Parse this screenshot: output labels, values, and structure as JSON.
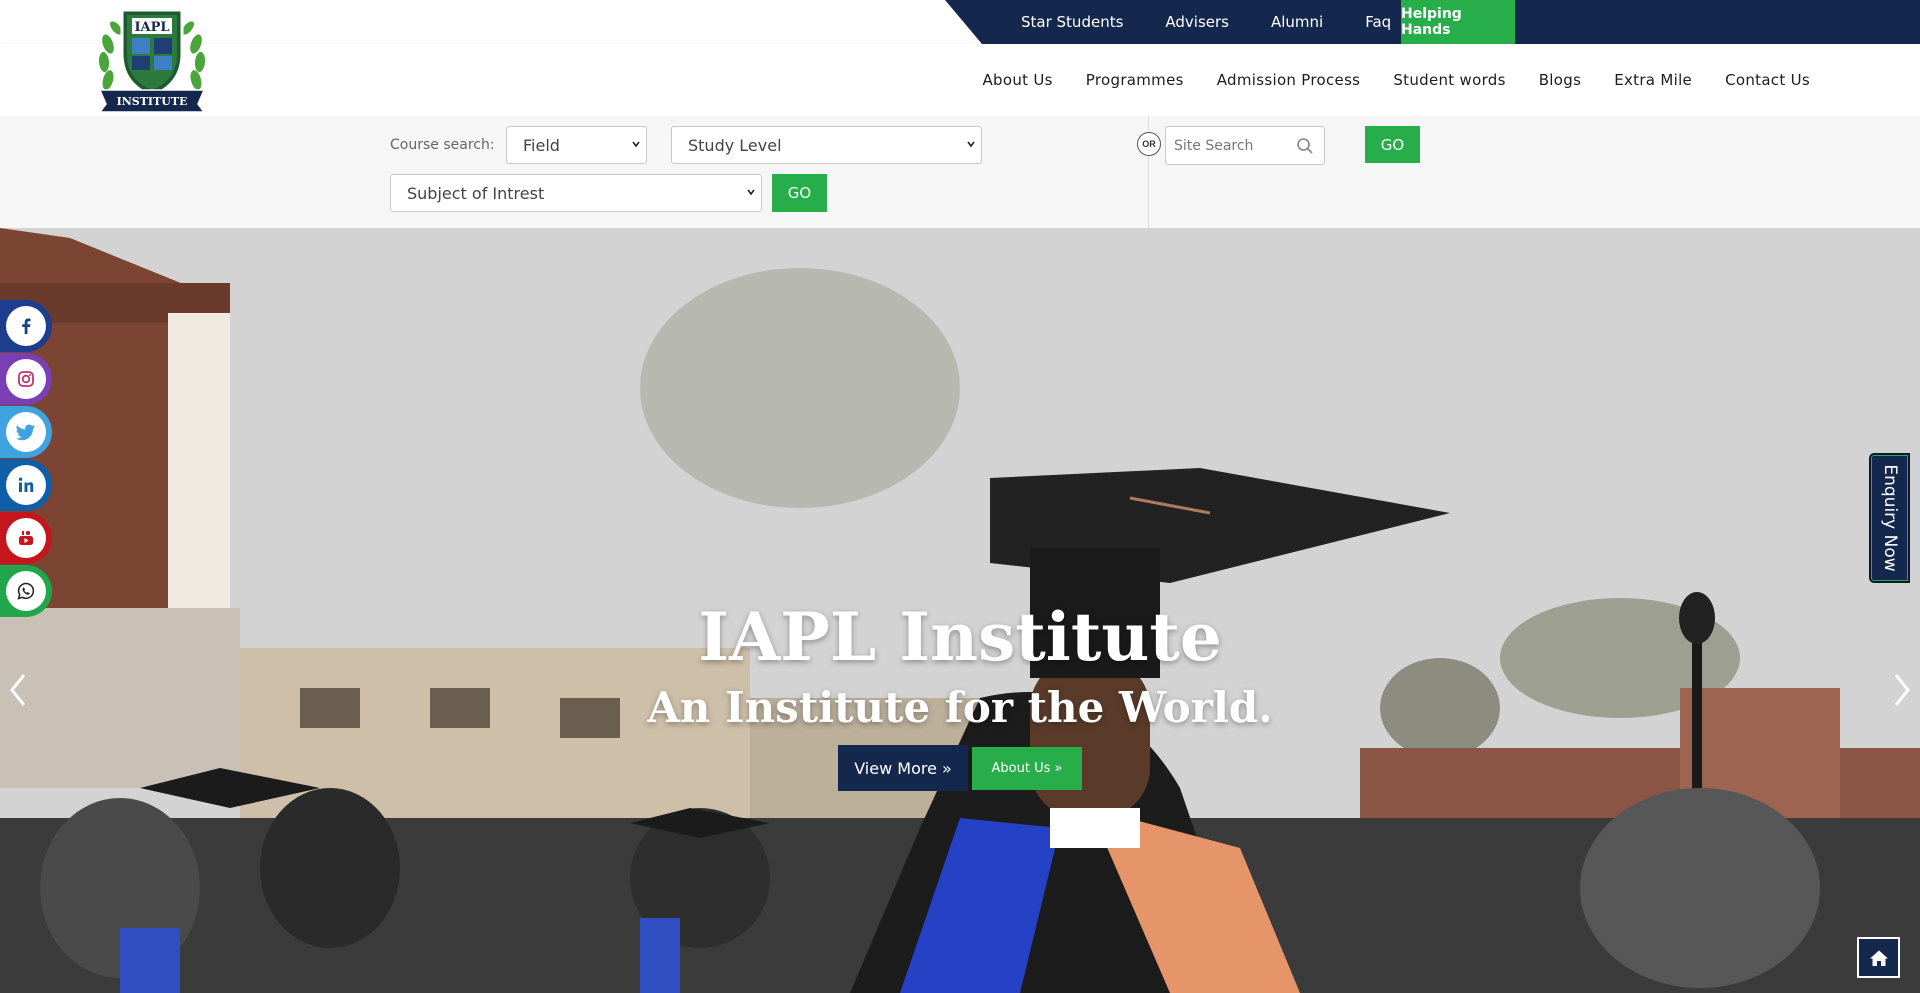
{
  "topbar": {
    "links": [
      "Star Students",
      "Advisers",
      "Alumni",
      "Faq"
    ],
    "helping_hands": "Helping Hands"
  },
  "logo": {
    "text_top": "IAPL",
    "text_bottom": "INSTITUTE"
  },
  "mainnav": {
    "items": [
      "About Us",
      "Programmes",
      "Admission Process",
      "Student words",
      "Blogs",
      "Extra Mile",
      "Contact Us"
    ]
  },
  "search": {
    "label": "Course search:",
    "field_select": "Field",
    "study_level_select": "Study Level",
    "subject_select": "Subject of Intrest",
    "go": "GO",
    "or": "OR",
    "site_search_placeholder": "Site Search",
    "site_go": "GO"
  },
  "hero": {
    "title": "IAPL Institute",
    "subtitle": "An Institute for the World.",
    "view_more": "View More »",
    "about_us": "About Us »"
  },
  "social": [
    "facebook-icon",
    "instagram-icon",
    "twitter-icon",
    "linkedin-icon",
    "youtube-icon",
    "whatsapp-icon"
  ],
  "enquiry": "Enquiry Now",
  "colors": {
    "navy": "#14284e",
    "green": "#27ae4b",
    "facebook": "#1c3e8c",
    "instagram": "#7b3fb5",
    "twitter": "#3fa3e0",
    "linkedin": "#0e5ea8",
    "youtube": "#c4161c",
    "whatsapp": "#22a64b"
  }
}
